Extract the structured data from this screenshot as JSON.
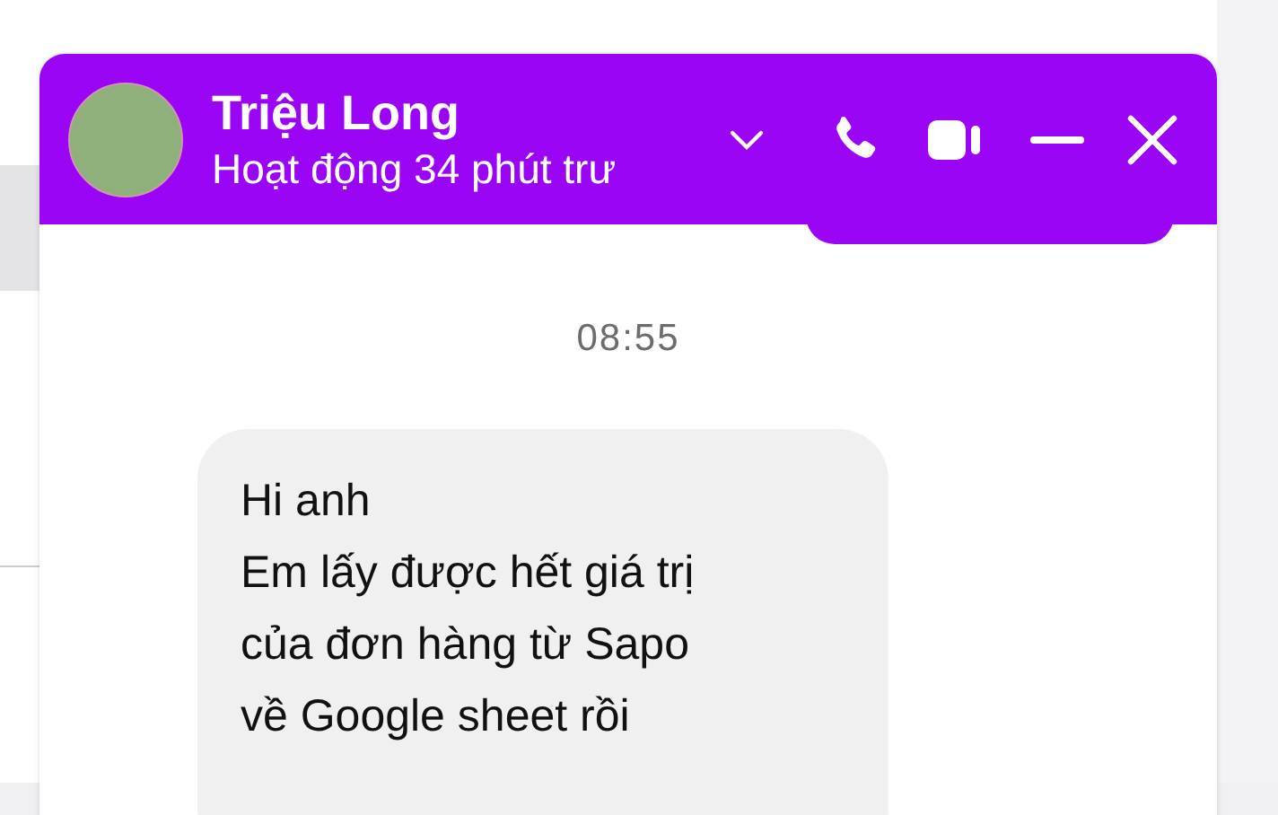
{
  "chat": {
    "contact_name": "Triệu Long",
    "status": "Hoạt động 34 phút trư",
    "timestamp": "08:55",
    "messages": [
      {
        "text": "Hi anh\nEm lấy được hết giá trị\ncủa đơn hàng từ Sapo\nvề Google sheet rồi",
        "incoming": true
      }
    ]
  }
}
